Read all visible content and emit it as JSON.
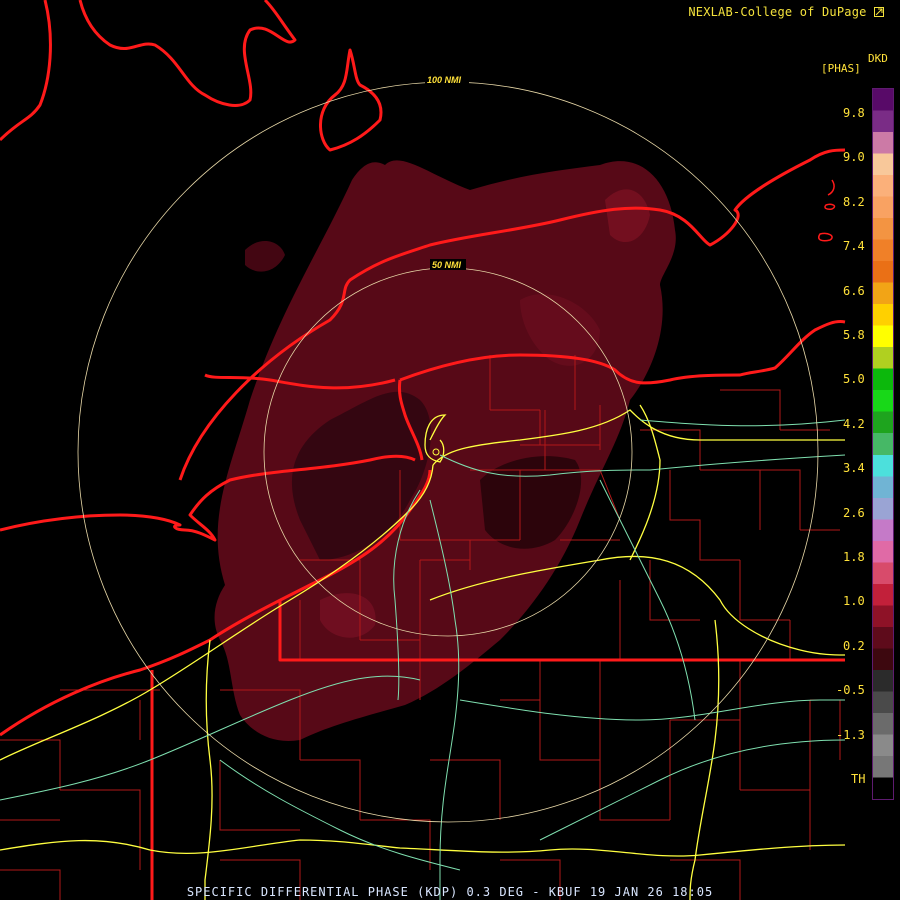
{
  "credit": "NEXLAB-College of DuPage",
  "credit_icon": "pointer-icon",
  "legend": {
    "code": "DKD",
    "unit": "[PHAS]",
    "ticks": [
      "9.8",
      "9.0",
      "8.2",
      "7.4",
      "6.6",
      "5.8",
      "5.0",
      "4.2",
      "3.4",
      "2.6",
      "1.8",
      "1.0",
      "0.2",
      "-0.5",
      "-1.3",
      "TH"
    ]
  },
  "range_rings": [
    "50 NMI",
    "100 NMI"
  ],
  "caption": "SPECIFIC DIFFERENTIAL PHASE (KDP) 0.3 DEG - KBUF 19 JAN 26 18:05",
  "colors": {
    "background": "#000000",
    "echo": "#5c0918",
    "state_border": "#ff1a1a",
    "county_border": "#b01818",
    "interstate": "#ffff40",
    "highway": "#7fe0b0",
    "range_ring": "#e9d9a8",
    "label": "#ffe13a"
  },
  "palette": [
    "#580a68",
    "#7a2c86",
    "#cc7aa6",
    "#f8c89a",
    "#fbb07a",
    "#f9a262",
    "#f39442",
    "#f08028",
    "#ea7016",
    "#f2a416",
    "#ffd000",
    "#ffff00",
    "#b0d020",
    "#0cb80c",
    "#18d818",
    "#1ea41e",
    "#46b866",
    "#4ce0dc",
    "#70b4d4",
    "#9aa4d4",
    "#c57ac8",
    "#e06aa6",
    "#d84b6b",
    "#c2203a",
    "#8e1227",
    "#5e0b1b",
    "#3d080f",
    "#2b2b2b",
    "#4a4a4a",
    "#6b6b6b",
    "#8a8a8a",
    "#777777",
    "#000000"
  ]
}
